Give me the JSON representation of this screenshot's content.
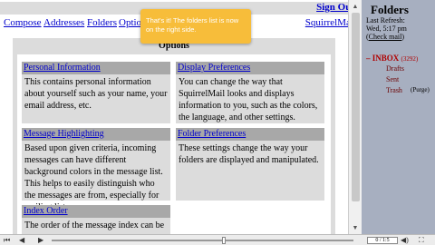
{
  "header": {
    "sign_out": "Sign Out",
    "nav": [
      "Compose",
      "Addresses",
      "Folders",
      "Optio"
    ],
    "squirrelmail": "SquirrelMail"
  },
  "tooltip": {
    "text": "That's it! The folders list is now on the right side."
  },
  "options": {
    "title": "Options",
    "panels": [
      {
        "title": "Personal Information",
        "desc": "This contains personal information about yourself such as your name, your email address, etc."
      },
      {
        "title": "Display Preferences",
        "desc": "You can change the way that SquirrelMail looks and displays information to you, such as the colors, the language, and other settings."
      },
      {
        "title": "Message Highlighting",
        "desc": "Based upon given criteria, incoming messages can have different background colors in the message list. This helps to easily distinguish who the messages are from, especially for mailing lists."
      },
      {
        "title": "Folder Preferences",
        "desc": "These settings change the way your folders are displayed and manipulated."
      },
      {
        "title": "Index Order",
        "desc": "The order of the message index can be"
      }
    ]
  },
  "sidebar": {
    "title": "Folders",
    "last_refresh_label": "Last Refresh:",
    "time": "Wed, 5:17 pm",
    "check_mail": "Check mail",
    "inbox": "INBOX",
    "inbox_count": "(3292)",
    "folders": [
      "Drafts",
      "Sent",
      "Trash"
    ],
    "purge": "(Purge)"
  },
  "player": {
    "counter": "0 / 1:5",
    "progress": 0.57
  },
  "colors": {
    "link": "#0000cc",
    "sidebar_bg": "#a7afc0",
    "tooltip_bg": "#f7bd3a",
    "inbox": "#b00000"
  }
}
